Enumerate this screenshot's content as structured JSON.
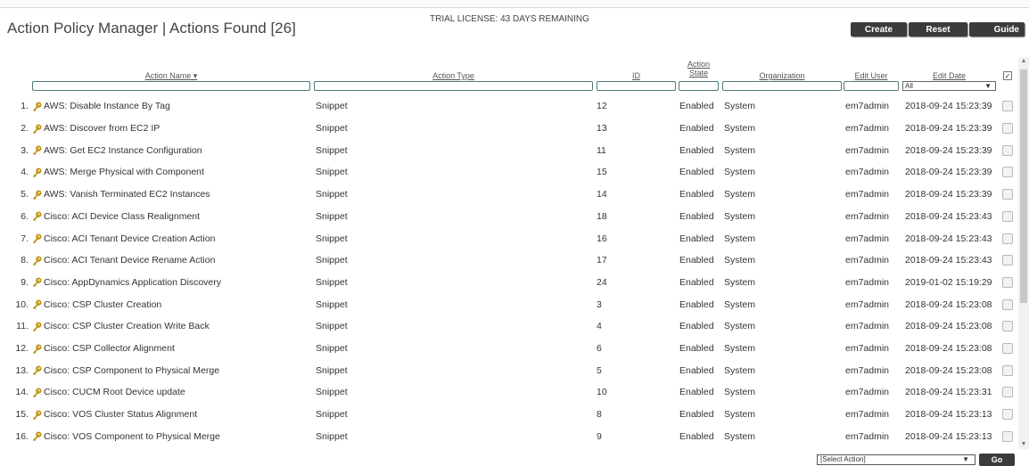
{
  "header": {
    "title": "Action Policy Manager | Actions Found [26]",
    "license": "TRIAL LICENSE: 43 DAYS REMAINING",
    "buttons": {
      "create": "Create",
      "reset": "Reset",
      "guide": "Guide"
    }
  },
  "columns": {
    "name": "Action Name ▾",
    "type": "Action Type",
    "id": "ID",
    "state_line1": "Action",
    "state_line2": "State",
    "org": "Organization",
    "user": "Edit User",
    "date": "Edit Date"
  },
  "filters": {
    "date_select": "All"
  },
  "rows": [
    {
      "num": "1.",
      "name": "AWS: Disable Instance By Tag",
      "type": "Snippet",
      "id": "12",
      "state": "Enabled",
      "org": "System",
      "user": "em7admin",
      "date": "2018-09-24 15:23:39"
    },
    {
      "num": "2.",
      "name": "AWS: Discover from EC2 IP",
      "type": "Snippet",
      "id": "13",
      "state": "Enabled",
      "org": "System",
      "user": "em7admin",
      "date": "2018-09-24 15:23:39"
    },
    {
      "num": "3.",
      "name": "AWS: Get EC2 Instance Configuration",
      "type": "Snippet",
      "id": "11",
      "state": "Enabled",
      "org": "System",
      "user": "em7admin",
      "date": "2018-09-24 15:23:39"
    },
    {
      "num": "4.",
      "name": "AWS: Merge Physical with Component",
      "type": "Snippet",
      "id": "15",
      "state": "Enabled",
      "org": "System",
      "user": "em7admin",
      "date": "2018-09-24 15:23:39"
    },
    {
      "num": "5.",
      "name": "AWS: Vanish Terminated EC2 Instances",
      "type": "Snippet",
      "id": "14",
      "state": "Enabled",
      "org": "System",
      "user": "em7admin",
      "date": "2018-09-24 15:23:39"
    },
    {
      "num": "6.",
      "name": "Cisco: ACI Device Class Realignment",
      "type": "Snippet",
      "id": "18",
      "state": "Enabled",
      "org": "System",
      "user": "em7admin",
      "date": "2018-09-24 15:23:43"
    },
    {
      "num": "7.",
      "name": "Cisco: ACI Tenant Device Creation Action",
      "type": "Snippet",
      "id": "16",
      "state": "Enabled",
      "org": "System",
      "user": "em7admin",
      "date": "2018-09-24 15:23:43"
    },
    {
      "num": "8.",
      "name": "Cisco: ACI Tenant Device Rename Action",
      "type": "Snippet",
      "id": "17",
      "state": "Enabled",
      "org": "System",
      "user": "em7admin",
      "date": "2018-09-24 15:23:43"
    },
    {
      "num": "9.",
      "name": "Cisco: AppDynamics Application Discovery",
      "type": "Snippet",
      "id": "24",
      "state": "Enabled",
      "org": "System",
      "user": "em7admin",
      "date": "2019-01-02 15:19:29"
    },
    {
      "num": "10.",
      "name": "Cisco: CSP Cluster Creation",
      "type": "Snippet",
      "id": "3",
      "state": "Enabled",
      "org": "System",
      "user": "em7admin",
      "date": "2018-09-24 15:23:08"
    },
    {
      "num": "11.",
      "name": "Cisco: CSP Cluster Creation Write Back",
      "type": "Snippet",
      "id": "4",
      "state": "Enabled",
      "org": "System",
      "user": "em7admin",
      "date": "2018-09-24 15:23:08"
    },
    {
      "num": "12.",
      "name": "Cisco: CSP Collector Alignment",
      "type": "Snippet",
      "id": "6",
      "state": "Enabled",
      "org": "System",
      "user": "em7admin",
      "date": "2018-09-24 15:23:08"
    },
    {
      "num": "13.",
      "name": "Cisco: CSP Component to Physical Merge",
      "type": "Snippet",
      "id": "5",
      "state": "Enabled",
      "org": "System",
      "user": "em7admin",
      "date": "2018-09-24 15:23:08"
    },
    {
      "num": "14.",
      "name": "Cisco: CUCM Root Device update",
      "type": "Snippet",
      "id": "10",
      "state": "Enabled",
      "org": "System",
      "user": "em7admin",
      "date": "2018-09-24 15:23:31"
    },
    {
      "num": "15.",
      "name": "Cisco: VOS Cluster Status Alignment",
      "type": "Snippet",
      "id": "8",
      "state": "Enabled",
      "org": "System",
      "user": "em7admin",
      "date": "2018-09-24 15:23:13"
    },
    {
      "num": "16.",
      "name": "Cisco: VOS Component to Physical Merge",
      "type": "Snippet",
      "id": "9",
      "state": "Enabled",
      "org": "System",
      "user": "em7admin",
      "date": "2018-09-24 15:23:13"
    }
  ],
  "footer": {
    "select_action": "[Select Action]",
    "go": "Go"
  },
  "icons": {
    "row_icon": "key-icon",
    "accent": "#d9a400"
  }
}
